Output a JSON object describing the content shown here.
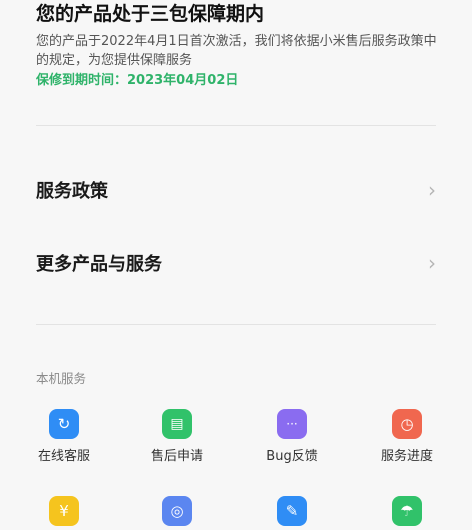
{
  "warranty": {
    "title": "您的产品处于三包保障期内",
    "description": "您的产品于2022年4月1日首次激活，我们将依据小米售后服务政策中的规定，为您提供保障服务",
    "expiry": "保修到期时间：2023年04月02日"
  },
  "menu": {
    "items": [
      {
        "label": "服务政策"
      },
      {
        "label": "更多产品与服务"
      }
    ]
  },
  "local_services": {
    "section_label": "本机服务",
    "tiles": [
      {
        "label": "在线客服",
        "icon": "refresh-chat-icon",
        "color": "#2f8df5",
        "glyph": "↻"
      },
      {
        "label": "售后申请",
        "icon": "document-icon",
        "color": "#31c26a",
        "glyph": "▤"
      },
      {
        "label": "Bug反馈",
        "icon": "message-bubble-icon",
        "color": "#8a6cf0",
        "glyph": "···"
      },
      {
        "label": "服务进度",
        "icon": "clock-icon",
        "color": "#f0674f",
        "glyph": "◷"
      }
    ],
    "tiles_row2": [
      {
        "icon": "yen-icon",
        "color": "#f5c41e",
        "glyph": "¥"
      },
      {
        "icon": "spiral-icon",
        "color": "#5b86f0",
        "glyph": "◎"
      },
      {
        "icon": "wrench-icon",
        "color": "#2f8df5",
        "glyph": "✎"
      },
      {
        "icon": "umbrella-icon",
        "color": "#31c26a",
        "glyph": "☂"
      }
    ]
  }
}
